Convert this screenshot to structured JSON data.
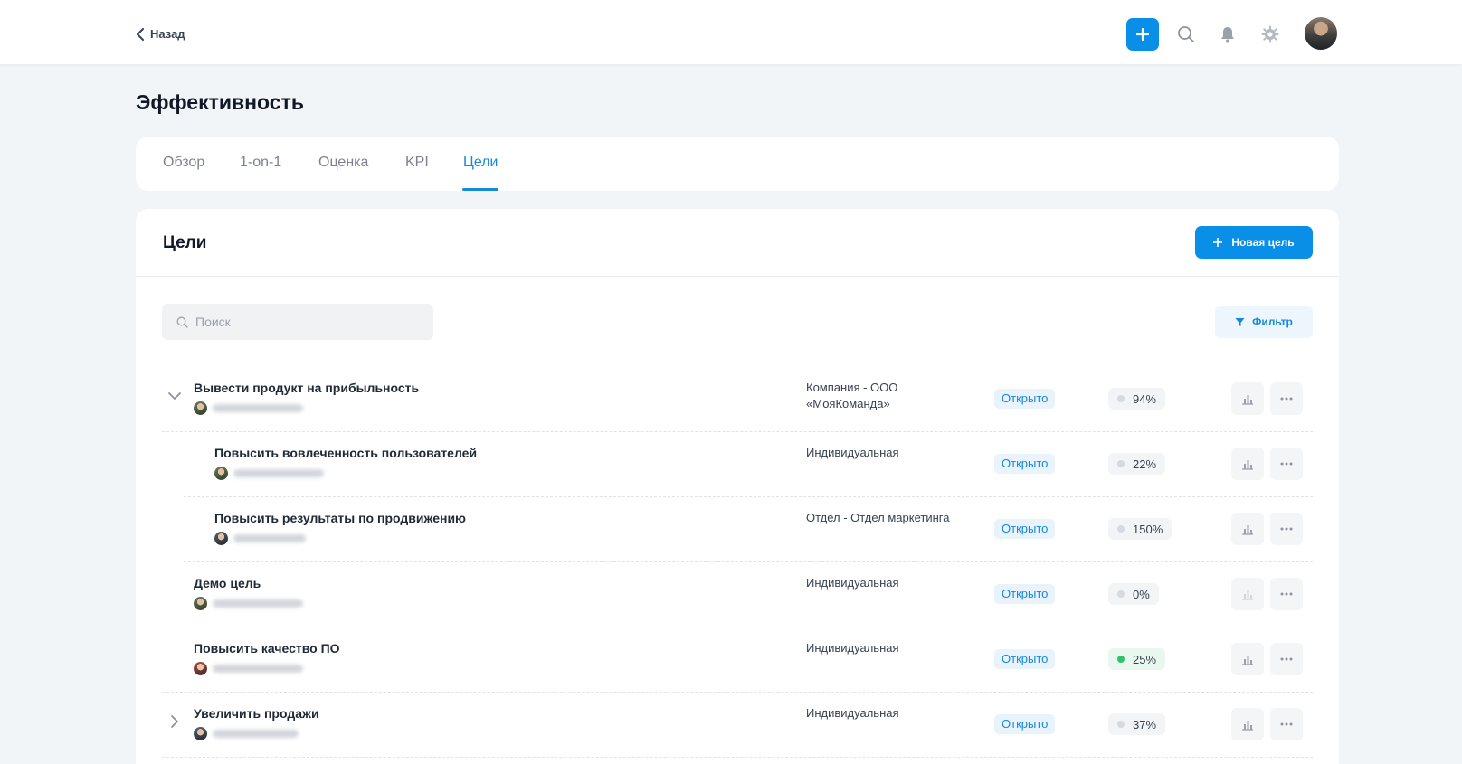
{
  "header": {
    "back_label": "Назад",
    "icons": [
      "plus-icon",
      "search-icon",
      "bell-icon",
      "gear-icon"
    ]
  },
  "page": {
    "title": "Эффективность"
  },
  "tabs": [
    {
      "label": "Обзор",
      "active": false
    },
    {
      "label": "1-on-1",
      "active": false
    },
    {
      "label": "Оценка",
      "active": false
    },
    {
      "label": "KPI",
      "active": false
    },
    {
      "label": "Цели",
      "active": true
    }
  ],
  "goals_section": {
    "title": "Цели",
    "new_goal_label": "Новая цель",
    "search_placeholder": "Поиск",
    "filter_label": "Фильтр"
  },
  "goals": [
    {
      "title": "Вывести продукт на прибыльность",
      "type": "Компания - ООО «МояКоманда»",
      "status": "Открыто",
      "progress": "94%",
      "level": 0,
      "expandable": "expanded",
      "progress_color": "#d6dae0"
    },
    {
      "title": "Повысить вовлеченность пользователей",
      "type": "Индивидуальная",
      "status": "Открыто",
      "progress": "22%",
      "level": 1,
      "expandable": "none",
      "progress_color": "#d6dae0"
    },
    {
      "title": "Повысить результаты по продвижению",
      "type": "Отдел - Отдел маркетинга",
      "status": "Открыто",
      "progress": "150%",
      "level": 1,
      "expandable": "none",
      "progress_color": "#d6dae0"
    },
    {
      "title": "Демо цель",
      "type": "Индивидуальная",
      "status": "Открыто",
      "progress": "0%",
      "level": 0,
      "expandable": "none",
      "progress_color": "#d6dae0"
    },
    {
      "title": "Повысить качество ПО",
      "type": "Индивидуальная",
      "status": "Открыто",
      "progress": "25%",
      "level": 0,
      "expandable": "none",
      "progress_color": "#2ec26a"
    },
    {
      "title": "Увеличить продажи",
      "type": "Индивидуальная",
      "status": "Открыто",
      "progress": "37%",
      "level": 0,
      "expandable": "collapsed",
      "progress_color": "#d6dae0"
    }
  ],
  "colors": {
    "accent": "#0a8fe8",
    "status_bg": "#e8f3fc",
    "success": "#2ec26a"
  }
}
